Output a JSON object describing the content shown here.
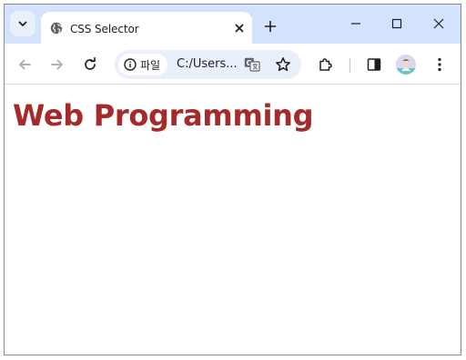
{
  "browser": {
    "tab": {
      "title": "CSS Selector"
    },
    "address_bar": {
      "chip_label": "파일",
      "url": "C:/Users..."
    }
  },
  "page": {
    "heading": "Web Programming",
    "heading_color": "#a52a2a"
  },
  "icons": {
    "tab_search": "chevron-down-icon",
    "tab_favicon": "globe-icon",
    "tab_close": "close-icon",
    "new_tab": "plus-icon",
    "minimize": "minimize-icon",
    "maximize": "maximize-icon",
    "close_window": "close-icon",
    "back": "back-arrow-icon",
    "forward": "forward-arrow-icon",
    "reload": "reload-icon",
    "site_info": "info-icon",
    "translate": "translate-icon",
    "bookmark": "star-icon",
    "extensions": "puzzle-icon",
    "side_panel": "side-panel-icon",
    "menu": "kebab-menu-icon"
  }
}
